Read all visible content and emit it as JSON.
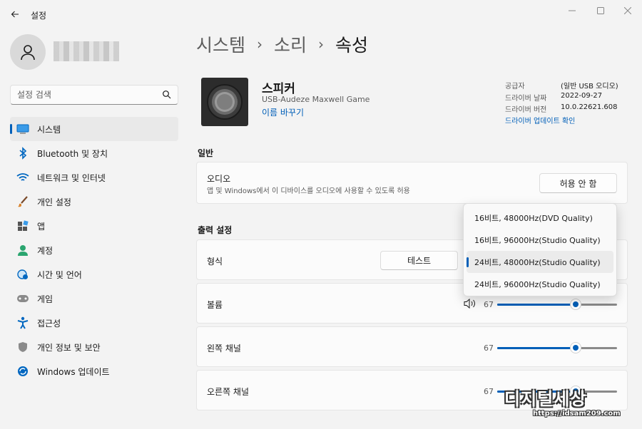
{
  "titlebar": {
    "app_title": "설정"
  },
  "sidebar": {
    "search_placeholder": "설정 검색",
    "items": [
      {
        "label": "시스템",
        "icon": "monitor-icon",
        "active": true
      },
      {
        "label": "Bluetooth 및 장치",
        "icon": "bluetooth-icon"
      },
      {
        "label": "네트워크 및 인터넷",
        "icon": "wifi-icon"
      },
      {
        "label": "개인 설정",
        "icon": "brush-icon"
      },
      {
        "label": "앱",
        "icon": "apps-icon"
      },
      {
        "label": "계정",
        "icon": "account-icon"
      },
      {
        "label": "시간 및 언어",
        "icon": "globe-clock-icon"
      },
      {
        "label": "게임",
        "icon": "gamepad-icon"
      },
      {
        "label": "접근성",
        "icon": "accessibility-icon"
      },
      {
        "label": "개인 정보 및 보안",
        "icon": "shield-icon"
      },
      {
        "label": "Windows 업데이트",
        "icon": "update-icon"
      }
    ]
  },
  "breadcrumb": {
    "level1": "시스템",
    "level2": "소리",
    "current": "속성",
    "separator": "›"
  },
  "device": {
    "name": "스피커",
    "model": "USB-Audeze Maxwell Game",
    "rename_link": "이름 바꾸기",
    "info": [
      {
        "label": "공급자",
        "value": "(일반 USB 오디오)"
      },
      {
        "label": "드라이버 날짜",
        "value": "2022-09-27"
      },
      {
        "label": "드라이버 버전",
        "value": "10.0.22621.608"
      }
    ],
    "driver_update_link": "드라이버 업데이트 확인"
  },
  "general": {
    "section_title": "일반",
    "audio_title": "오디오",
    "audio_desc": "앱 및 Windows에서 이 디바이스를 오디오에 사용할 수 있도록 허용",
    "disallow_button": "허용 안 함"
  },
  "output": {
    "section_title": "출력 설정",
    "format_label": "형식",
    "test_button": "테스트",
    "volume_label": "볼륨",
    "volume_value": "67",
    "left_channel_label": "왼쪽 채널",
    "left_channel_value": "67",
    "right_channel_label": "오른쪽 채널",
    "right_channel_value": "67"
  },
  "format_dropdown": {
    "options": [
      "16비트, 48000Hz(DVD Quality)",
      "16비트, 96000Hz(Studio Quality)",
      "24비트, 48000Hz(Studio Quality)",
      "24비트, 96000Hz(Studio Quality)"
    ],
    "selected_index": 2
  },
  "watermark": {
    "big": "디지털세상",
    "url": "https://idsam209.com"
  },
  "colors": {
    "accent": "#005fb8",
    "background": "#f3f3f3",
    "card": "#fbfbfb"
  }
}
